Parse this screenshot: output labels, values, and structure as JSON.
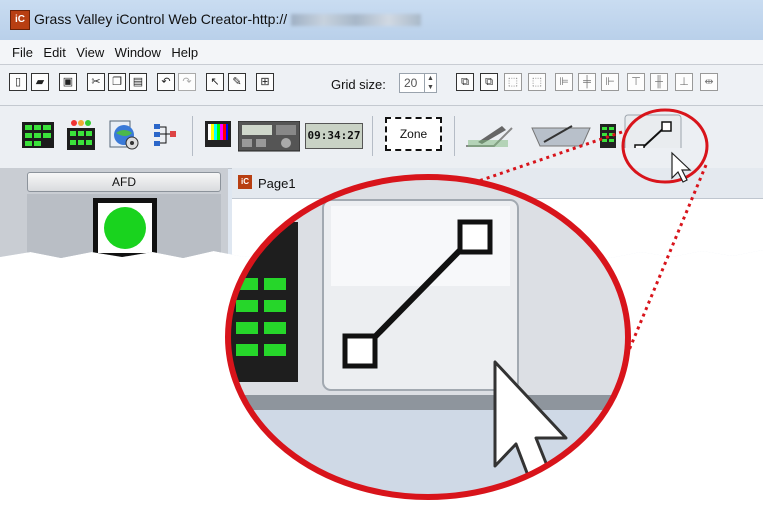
{
  "window": {
    "title": "Grass Valley iControl Web Creator-http://",
    "app_icon": "iC",
    "accent": "#d8141b"
  },
  "menu": [
    "File",
    "Edit",
    "View",
    "Window",
    "Help"
  ],
  "toolbar": {
    "grid_size_label": "Grid size:",
    "grid_size_value": "20"
  },
  "palette": {
    "clock_text": "09:34:27",
    "zone_label": "Zone"
  },
  "left_panel": {
    "afd_label": "AFD"
  },
  "page": {
    "tab_label": "Page1"
  }
}
